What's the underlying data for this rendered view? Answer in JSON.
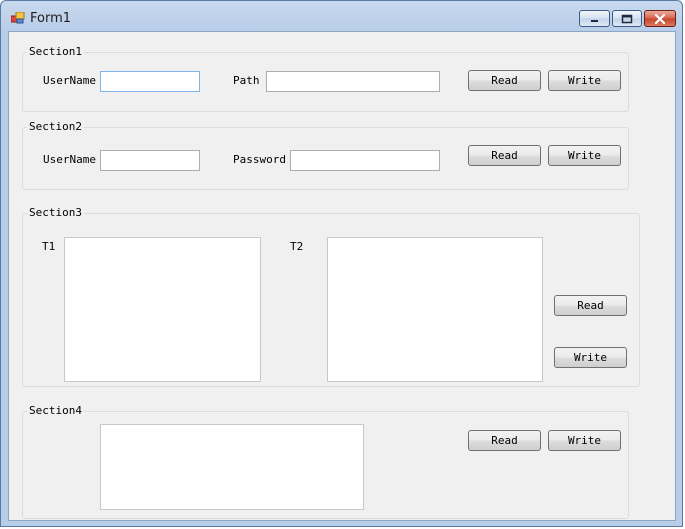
{
  "window": {
    "title": "Form1",
    "icon": "form-app-icon",
    "controls": {
      "minimize_icon": "minimize-icon",
      "maximize_icon": "maximize-icon",
      "close_icon": "close-icon"
    }
  },
  "section1": {
    "legend": "Section1",
    "username_label": "UserName",
    "username_value": "",
    "path_label": "Path",
    "path_value": "",
    "read_label": "Read",
    "write_label": "Write"
  },
  "section2": {
    "legend": "Section2",
    "username_label": "UserName",
    "username_value": "",
    "password_label": "Password",
    "password_value": "",
    "read_label": "Read",
    "write_label": "Write"
  },
  "section3": {
    "legend": "Section3",
    "t1_label": "T1",
    "t1_value": "",
    "t2_label": "T2",
    "t2_value": "",
    "read_label": "Read",
    "write_label": "Write"
  },
  "section4": {
    "legend": "Section4",
    "text_value": "",
    "read_label": "Read",
    "write_label": "Write"
  },
  "colors": {
    "titlebar": "#b8cde8",
    "client_background": "#f0f0f0",
    "close_button": "#c4452c",
    "focus_border": "#7eb4ea"
  }
}
